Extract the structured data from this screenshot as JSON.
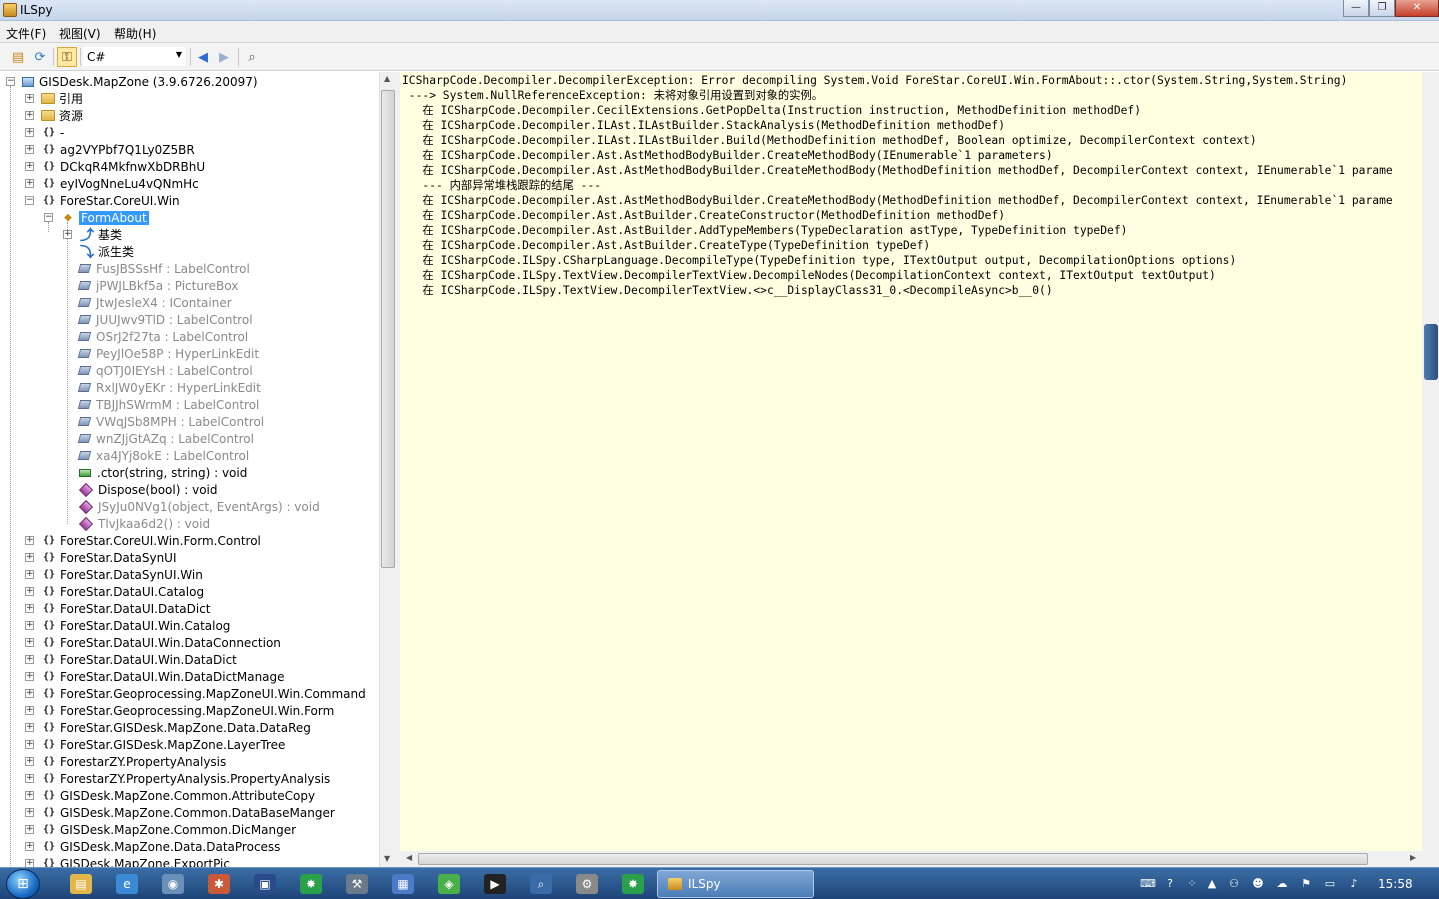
{
  "window": {
    "title": "ILSpy",
    "minimize": "—",
    "restore": "❐",
    "close": "✕"
  },
  "menu": {
    "file": "文件(F)",
    "view": "视图(V)",
    "help": "帮助(H)"
  },
  "toolbar": {
    "language": "C#"
  },
  "tree": {
    "root": "GISDesk.MapZone (3.9.6726.20097)",
    "nodes": [
      {
        "label": "引用"
      },
      {
        "label": "资源"
      },
      {
        "label": "-"
      },
      {
        "label": "ag2VYPbf7Q1Ly0Z5BR"
      },
      {
        "label": "DCkqR4MkfnwXbDRBhU"
      },
      {
        "label": "eyIVogNneLu4vQNmHc"
      },
      {
        "label": "ForeStar.CoreUI.Win"
      }
    ],
    "selected_class": "FormAbout",
    "class_children": {
      "base_types": "基类",
      "derived_types": "派生类",
      "fields": [
        "FusJBSSsHf : LabelControl",
        "jPWJLBkf5a : PictureBox",
        "JtwJesleX4 : IContainer",
        "JUUJwv9TlD : LabelControl",
        "OSrJ2f27ta : LabelControl",
        "PeyJlOe58P : HyperLinkEdit",
        "qOTJ0IEYsH : LabelControl",
        "RxlJW0yEKr : HyperLinkEdit",
        "TBJJhSWrmM : LabelControl",
        "VWqJSb8MPH : LabelControl",
        "wnZJjGtAZq : LabelControl",
        "xa4JYj8okE : LabelControl"
      ],
      "ctor": ".ctor(string, string) : void",
      "dispose": "Dispose(bool) : void",
      "methods_gray": [
        "JSyJu0NVg1(object, EventArgs) : void",
        "TlvJkaa6d2() : void"
      ]
    },
    "namespaces_after": [
      "ForeStar.CoreUI.Win.Form.Control",
      "ForeStar.DataSynUI",
      "ForeStar.DataSynUI.Win",
      "ForeStar.DataUI.Catalog",
      "ForeStar.DataUI.DataDict",
      "ForeStar.DataUI.Win.Catalog",
      "ForeStar.DataUI.Win.DataConnection",
      "ForeStar.DataUI.Win.DataDict",
      "ForeStar.DataUI.Win.DataDictManage",
      "ForeStar.Geoprocessing.MapZoneUI.Win.Command",
      "ForeStar.Geoprocessing.MapZoneUI.Win.Form",
      "ForeStar.GISDesk.MapZone.Data.DataReg",
      "ForeStar.GISDesk.MapZone.LayerTree",
      "ForestarZY.PropertyAnalysis",
      "ForestarZY.PropertyAnalysis.PropertyAnalysis",
      "GISDesk.MapZone.Common.AttributeCopy",
      "GISDesk.MapZone.Common.DataBaseManger",
      "GISDesk.MapZone.Common.DicManger",
      "GISDesk.MapZone.Data.DataProcess",
      "GISDesk.MapZone.ExportPic"
    ]
  },
  "code": {
    "lines": [
      "ICSharpCode.Decompiler.DecompilerException: Error decompiling System.Void ForeStar.CoreUI.Win.FormAbout::.ctor(System.String,System.String)",
      " ---> System.NullReferenceException: 未将对象引用设置到对象的实例。",
      "   在 ICSharpCode.Decompiler.CecilExtensions.GetPopDelta(Instruction instruction, MethodDefinition methodDef)",
      "   在 ICSharpCode.Decompiler.ILAst.ILAstBuilder.StackAnalysis(MethodDefinition methodDef)",
      "   在 ICSharpCode.Decompiler.ILAst.ILAstBuilder.Build(MethodDefinition methodDef, Boolean optimize, DecompilerContext context)",
      "   在 ICSharpCode.Decompiler.Ast.AstMethodBodyBuilder.CreateMethodBody(IEnumerable`1 parameters)",
      "   在 ICSharpCode.Decompiler.Ast.AstMethodBodyBuilder.CreateMethodBody(MethodDefinition methodDef, DecompilerContext context, IEnumerable`1 parame",
      "   --- 内部异常堆栈跟踪的结尾 ---",
      "   在 ICSharpCode.Decompiler.Ast.AstMethodBodyBuilder.CreateMethodBody(MethodDefinition methodDef, DecompilerContext context, IEnumerable`1 parame",
      "   在 ICSharpCode.Decompiler.Ast.AstBuilder.CreateConstructor(MethodDefinition methodDef)",
      "   在 ICSharpCode.Decompiler.Ast.AstBuilder.AddTypeMembers(TypeDeclaration astType, TypeDefinition typeDef)",
      "   在 ICSharpCode.Decompiler.Ast.AstBuilder.CreateType(TypeDefinition typeDef)",
      "   在 ICSharpCode.ILSpy.CSharpLanguage.DecompileType(TypeDefinition type, ITextOutput output, DecompilationOptions options)",
      "   在 ICSharpCode.ILSpy.TextView.DecompilerTextView.DecompileNodes(DecompilationContext context, ITextOutput textOutput)",
      "   在 ICSharpCode.ILSpy.TextView.DecompilerTextView.<>c__DisplayClass31_0.<DecompileAsync>b__0()"
    ]
  },
  "taskbar": {
    "active_task": "ILSpy",
    "clock": "15:58"
  }
}
